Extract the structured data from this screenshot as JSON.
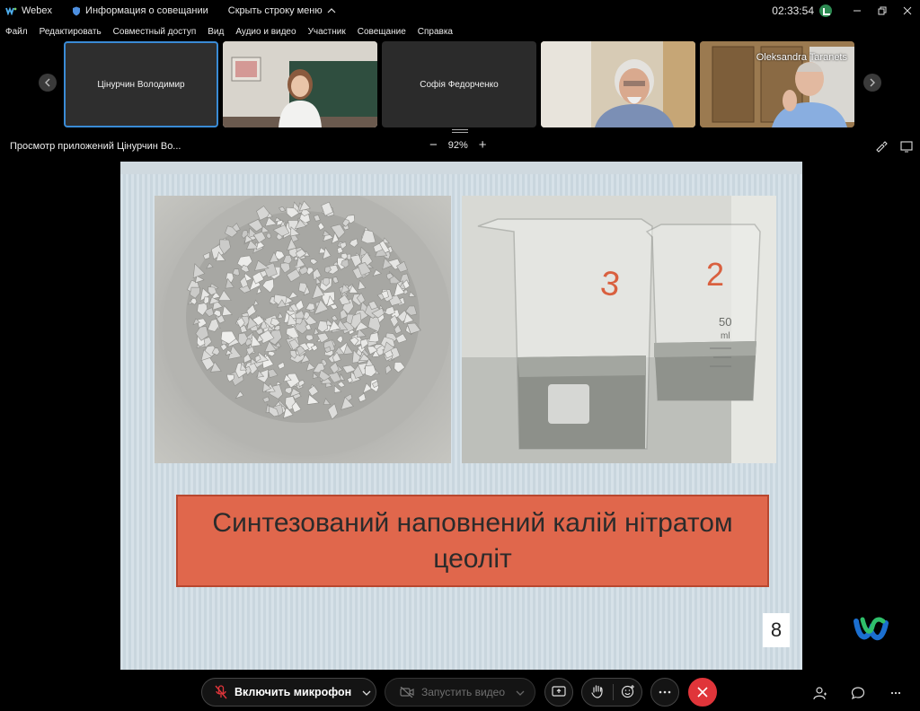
{
  "titlebar": {
    "app_name": "Webex",
    "meeting_info": "Информация о совещании",
    "hide_menu": "Скрыть строку меню",
    "time": "02:33:54"
  },
  "menu": {
    "items": [
      {
        "label": "Файл"
      },
      {
        "label": "Редактировать"
      },
      {
        "label": "Совместный доступ"
      },
      {
        "label": "Вид"
      },
      {
        "label": "Аудио и видео"
      },
      {
        "label": "Участник"
      },
      {
        "label": "Совещание"
      },
      {
        "label": "Справка"
      }
    ]
  },
  "participants": [
    {
      "name": "Цінурчин Володимир",
      "video": false
    },
    {
      "name": "",
      "video": true
    },
    {
      "name": "Софія Федорченко",
      "video": false
    },
    {
      "name": "",
      "video": true
    },
    {
      "name": "Oleksandra Taranets",
      "video": true
    }
  ],
  "share": {
    "title": "Просмотр приложений Цінурчин Во...",
    "zoom": "92%"
  },
  "slide": {
    "caption": "Синтезований наповнений калій нітратом цеоліт",
    "page_number": "8",
    "beaker_labels": [
      "3",
      "2"
    ],
    "beaker_volume": "50",
    "beaker_unit": "ml"
  },
  "controls": {
    "mic_label": "Включить микрофон",
    "video_label": "Запустить видео"
  }
}
